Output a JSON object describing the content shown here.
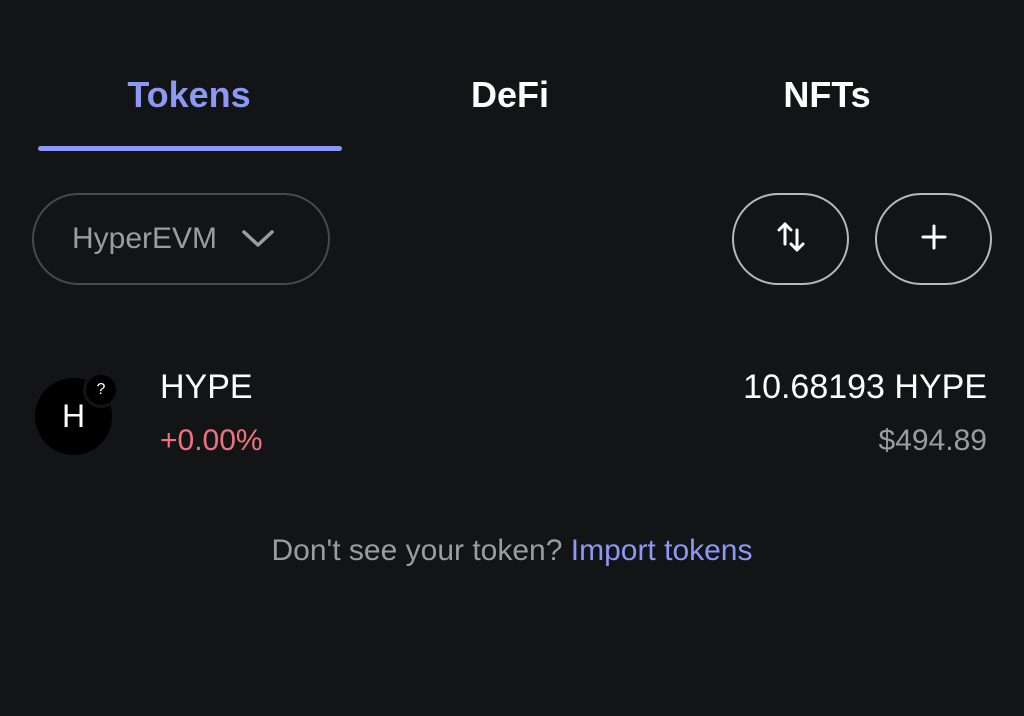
{
  "tabs": {
    "tokens": "Tokens",
    "defi": "DeFi",
    "nfts": "NFTs"
  },
  "filters": {
    "network": "HyperEVM",
    "network_icon": "chevron-down-icon",
    "sort_icon": "sort-arrows-icon",
    "add_icon": "plus-icon"
  },
  "token": {
    "avatar_letter": "H",
    "badge": "?",
    "symbol": "HYPE",
    "change": "+0.00%",
    "balance": "10.68193 HYPE",
    "fiat": "$494.89"
  },
  "import": {
    "question": "Don't see your token?",
    "link": "Import tokens"
  },
  "colors": {
    "background": "#131416",
    "accent": "#8b99f4",
    "negative": "#f0717f",
    "muted": "#9a9ca2"
  }
}
